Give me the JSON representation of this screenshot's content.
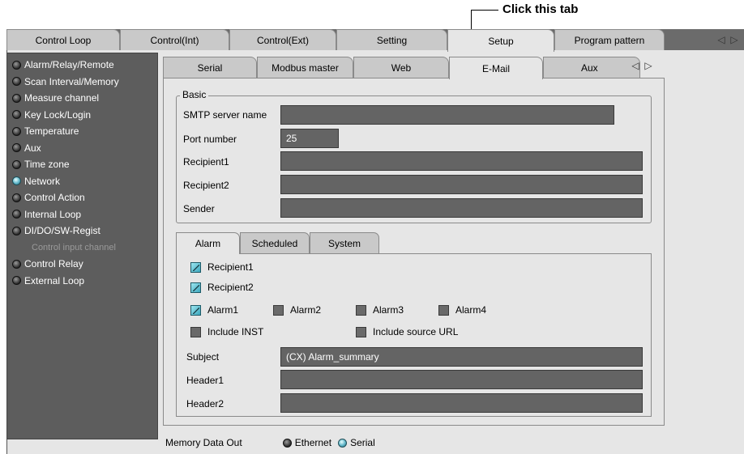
{
  "callout": {
    "text": "Click this tab"
  },
  "main_tabs": [
    {
      "label": "Control Loop",
      "active": false
    },
    {
      "label": "Control(Int)",
      "active": false
    },
    {
      "label": "Control(Ext)",
      "active": false
    },
    {
      "label": "Setting",
      "active": false
    },
    {
      "label": "Setup",
      "active": true
    },
    {
      "label": "Program pattern",
      "active": false
    }
  ],
  "sidebar": {
    "items": [
      {
        "label": "Alarm/Relay/Remote",
        "led": "off"
      },
      {
        "label": "Scan Interval/Memory",
        "led": "off"
      },
      {
        "label": "Measure channel",
        "led": "off"
      },
      {
        "label": "Key Lock/Login",
        "led": "off"
      },
      {
        "label": "Temperature",
        "led": "off"
      },
      {
        "label": "Aux",
        "led": "off"
      },
      {
        "label": "Time zone",
        "led": "off"
      },
      {
        "label": "Network",
        "led": "on"
      },
      {
        "label": "Control Action",
        "led": "off"
      },
      {
        "label": "Internal Loop",
        "led": "off"
      },
      {
        "label": "DI/DO/SW-Regist",
        "led": "off"
      },
      {
        "label": "Control input channel",
        "led": "none"
      },
      {
        "label": "Control Relay",
        "led": "off"
      },
      {
        "label": "External Loop",
        "led": "off"
      }
    ]
  },
  "sub_tabs": [
    {
      "label": "Serial",
      "active": false
    },
    {
      "label": "Modbus master",
      "active": false
    },
    {
      "label": "Web",
      "active": false
    },
    {
      "label": "E-Mail",
      "active": true
    },
    {
      "label": "Aux",
      "active": false
    }
  ],
  "basic": {
    "title": "Basic",
    "smtp_label": "SMTP server name",
    "smtp_value": "",
    "port_label": "Port number",
    "port_value": "25",
    "recipient1_label": "Recipient1",
    "recipient1_value": "",
    "recipient2_label": "Recipient2",
    "recipient2_value": "",
    "sender_label": "Sender",
    "sender_value": ""
  },
  "inner_tabs": [
    {
      "label": "Alarm",
      "active": true
    },
    {
      "label": "Scheduled",
      "active": false
    },
    {
      "label": "System",
      "active": false
    }
  ],
  "alarm": {
    "recipient1": {
      "label": "Recipient1",
      "checked": true
    },
    "recipient2": {
      "label": "Recipient2",
      "checked": true
    },
    "alarm1": {
      "label": "Alarm1",
      "checked": true
    },
    "alarm2": {
      "label": "Alarm2",
      "checked": false
    },
    "alarm3": {
      "label": "Alarm3",
      "checked": false
    },
    "alarm4": {
      "label": "Alarm4",
      "checked": false
    },
    "include_inst": {
      "label": "Include INST",
      "checked": false
    },
    "include_url": {
      "label": "Include source URL",
      "checked": false
    },
    "subject_label": "Subject",
    "subject_value": "(CX) Alarm_summary",
    "header1_label": "Header1",
    "header1_value": "",
    "header2_label": "Header2",
    "header2_value": ""
  },
  "footer": {
    "label": "Memory Data Out",
    "ethernet": {
      "label": "Ethernet",
      "selected": false
    },
    "serial": {
      "label": "Serial",
      "selected": true
    }
  },
  "colors": {
    "accent_led": "#5fb6c9",
    "field_bg": "#646464",
    "sidebar_bg": "#5d5d5d"
  }
}
